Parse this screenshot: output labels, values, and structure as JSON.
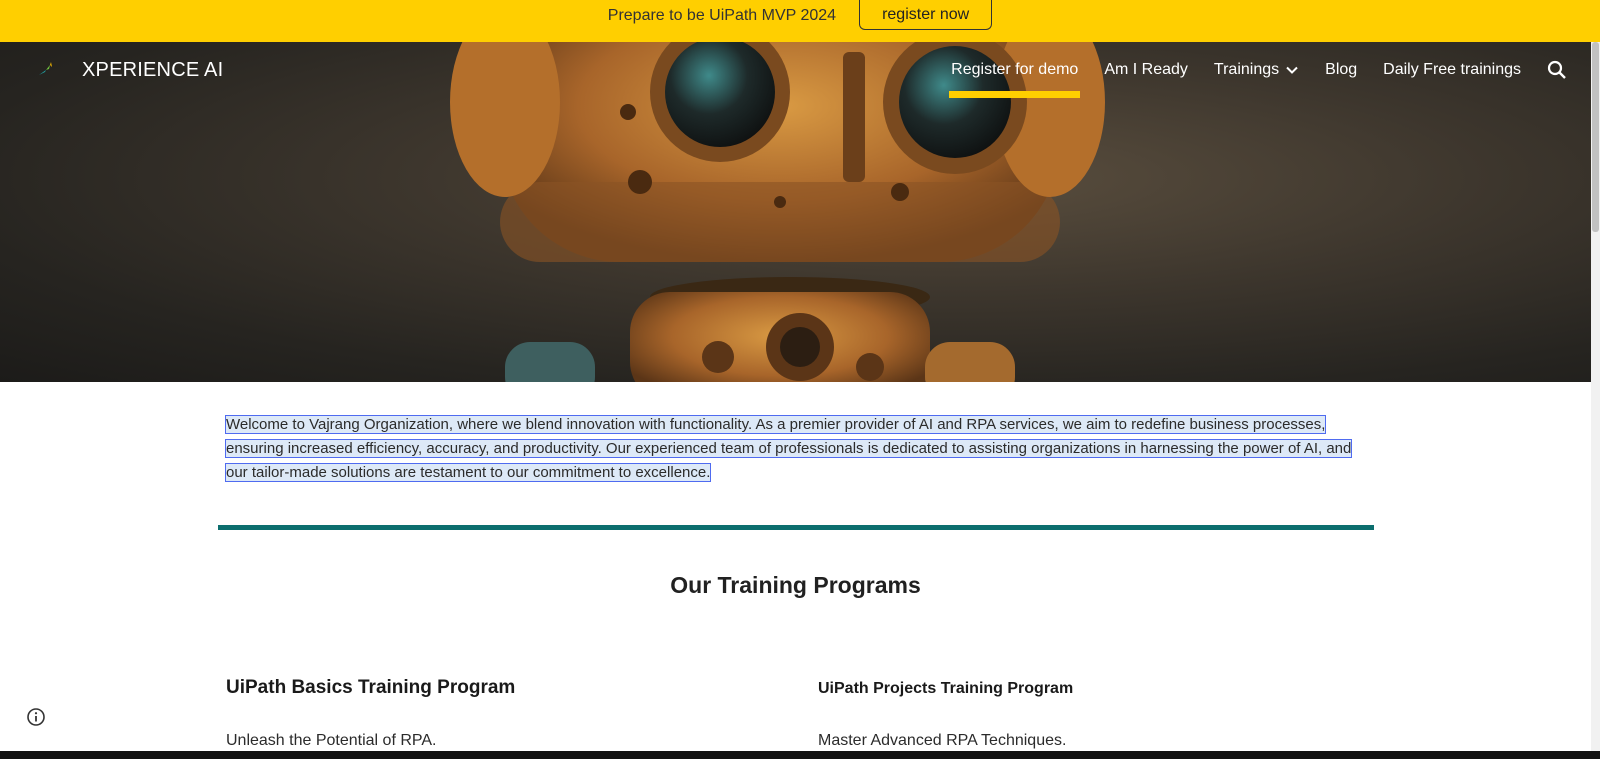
{
  "banner": {
    "message": "Prepare to be UiPath MVP 2024",
    "cta_label": "register now"
  },
  "nav": {
    "brand": "XPERIENCE AI",
    "links": [
      "Register for demo",
      "Am I Ready",
      "Trainings",
      "Blog",
      "Daily Free trainings"
    ],
    "active_index": 0
  },
  "intro": {
    "text": "Welcome to Vajrang Organization, where we blend innovation with functionality. As a premier provider of AI and RPA services, we aim to redefine business processes, ensuring increased efficiency, accuracy, and productivity. Our experienced team of professionals is dedicated to assisting organizations in harnessing the power of AI, and our tailor-made solutions are testament to our commitment to excellence."
  },
  "section": {
    "title": "Our Training Programs"
  },
  "programs": [
    {
      "title": "UiPath Basics Training Program",
      "description": "Unleash the Potential of RPA."
    },
    {
      "title": "UiPath Projects Training Program",
      "description": "Master Advanced RPA Techniques."
    }
  ],
  "colors": {
    "banner_bg": "#ffcf00",
    "active_underline": "#ffcf00",
    "divider": "#0c6e6e",
    "selection_outline": "#4f6bf0"
  },
  "icons": {
    "logo": "leaf-logo-icon",
    "trainings_dropdown": "chevron-down-icon",
    "search": "search-icon",
    "info": "info-icon"
  }
}
